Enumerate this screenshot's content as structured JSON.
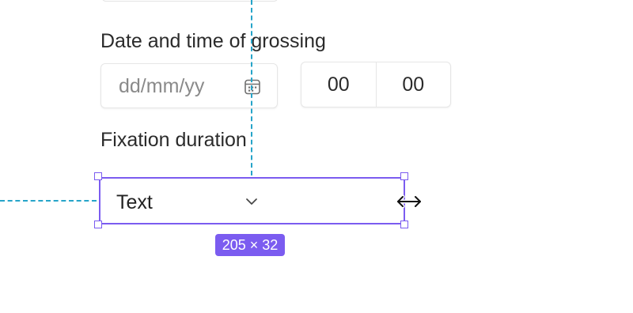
{
  "form": {
    "grossing_label": "Date and time of grossing",
    "date_placeholder": "dd/mm/yy",
    "hours_value": "00",
    "minutes_value": "00",
    "fixation_label": "Fixation duration",
    "fixation_value": "Text"
  },
  "selection": {
    "size_label": "205 × 32",
    "accent_color": "#7b5cf0",
    "guide_color": "#26a4c9"
  },
  "icons": {
    "date": "calendar-icon",
    "dropdown": "chevron-down-icon",
    "cursor": "horizontal-resize-cursor"
  }
}
